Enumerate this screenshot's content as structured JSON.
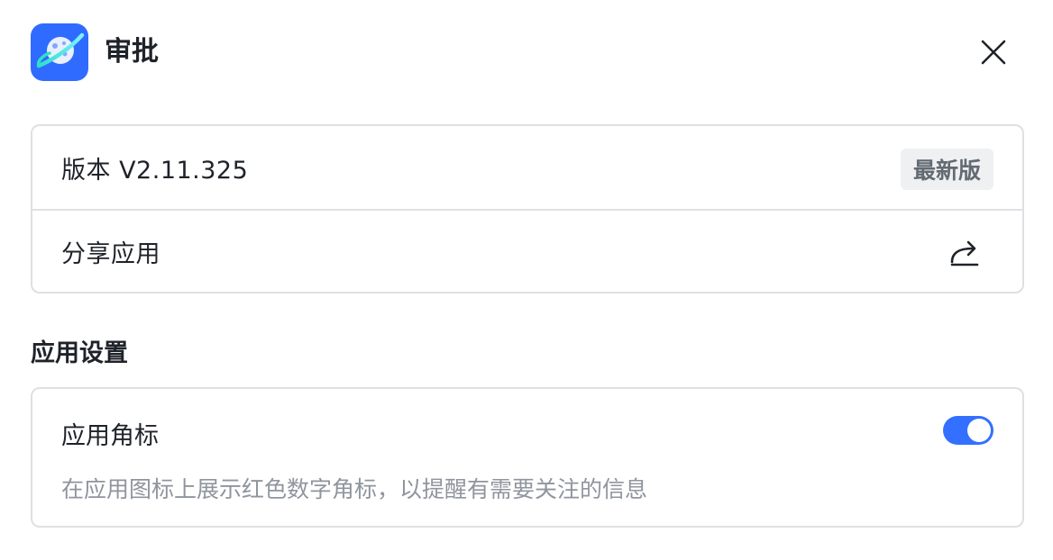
{
  "app": {
    "title": "审批",
    "icon": "planet-icon",
    "icon_bg": "#2f6bff"
  },
  "info_card": {
    "version_label": "版本 V2.11.325",
    "version_badge": "最新版",
    "share_label": "分享应用",
    "share_icon": "share-icon"
  },
  "settings": {
    "section_title": "应用设置",
    "badge_setting": {
      "label": "应用角标",
      "description": "在应用图标上展示红色数字角标，以提醒有需要关注的信息",
      "enabled": true,
      "accent": "#3370ff"
    }
  },
  "close_icon": "close-icon"
}
